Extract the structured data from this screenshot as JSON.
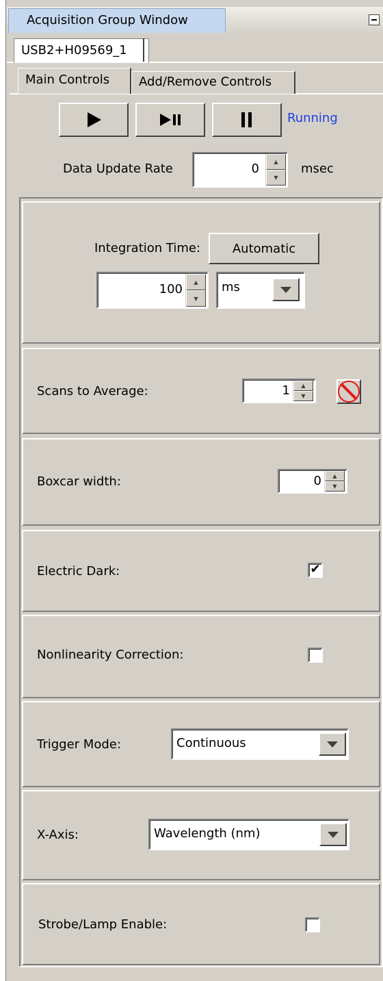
{
  "window": {
    "title": "Acquisition Group Window"
  },
  "device_tab": {
    "label": "USB2+H09569_1"
  },
  "tabs": [
    {
      "label": "Main Controls",
      "active": true
    },
    {
      "label": "Add/Remove Controls",
      "active": false
    }
  ],
  "toolbar": {
    "play_icon": "play-icon",
    "step_icon": "play-pause-icon",
    "pause_icon": "pause-icon",
    "status": "Running",
    "status_color": "#1f3fe0"
  },
  "update_rate": {
    "label": "Data Update Rate",
    "value": "0",
    "unit": "msec"
  },
  "integration": {
    "label": "Integration Time:",
    "auto_button": "Automatic",
    "value": "100",
    "unit": "ms"
  },
  "scans": {
    "label": "Scans to Average:",
    "value": "1"
  },
  "boxcar": {
    "label": "Boxcar width:",
    "value": "0"
  },
  "electric_dark": {
    "label": "Electric Dark:",
    "checked": true,
    "mark": "✔"
  },
  "nonlinearity": {
    "label": "Nonlinearity Correction:",
    "checked": false
  },
  "trigger": {
    "label": "Trigger Mode:",
    "value": "Continuous"
  },
  "xaxis": {
    "label": "X-Axis:",
    "value": "Wavelength (nm)"
  },
  "strobe": {
    "label": "Strobe/Lamp Enable:",
    "checked": false
  }
}
